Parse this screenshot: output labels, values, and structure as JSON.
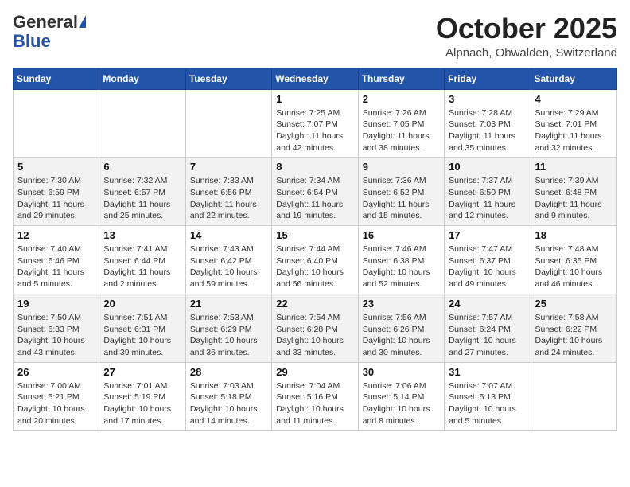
{
  "header": {
    "logo_general": "General",
    "logo_blue": "Blue",
    "month_title": "October 2025",
    "location": "Alpnach, Obwalden, Switzerland"
  },
  "days_of_week": [
    "Sunday",
    "Monday",
    "Tuesday",
    "Wednesday",
    "Thursday",
    "Friday",
    "Saturday"
  ],
  "weeks": [
    [
      {
        "day": "",
        "info": ""
      },
      {
        "day": "",
        "info": ""
      },
      {
        "day": "",
        "info": ""
      },
      {
        "day": "1",
        "info": "Sunrise: 7:25 AM\nSunset: 7:07 PM\nDaylight: 11 hours and 42 minutes."
      },
      {
        "day": "2",
        "info": "Sunrise: 7:26 AM\nSunset: 7:05 PM\nDaylight: 11 hours and 38 minutes."
      },
      {
        "day": "3",
        "info": "Sunrise: 7:28 AM\nSunset: 7:03 PM\nDaylight: 11 hours and 35 minutes."
      },
      {
        "day": "4",
        "info": "Sunrise: 7:29 AM\nSunset: 7:01 PM\nDaylight: 11 hours and 32 minutes."
      }
    ],
    [
      {
        "day": "5",
        "info": "Sunrise: 7:30 AM\nSunset: 6:59 PM\nDaylight: 11 hours and 29 minutes."
      },
      {
        "day": "6",
        "info": "Sunrise: 7:32 AM\nSunset: 6:57 PM\nDaylight: 11 hours and 25 minutes."
      },
      {
        "day": "7",
        "info": "Sunrise: 7:33 AM\nSunset: 6:56 PM\nDaylight: 11 hours and 22 minutes."
      },
      {
        "day": "8",
        "info": "Sunrise: 7:34 AM\nSunset: 6:54 PM\nDaylight: 11 hours and 19 minutes."
      },
      {
        "day": "9",
        "info": "Sunrise: 7:36 AM\nSunset: 6:52 PM\nDaylight: 11 hours and 15 minutes."
      },
      {
        "day": "10",
        "info": "Sunrise: 7:37 AM\nSunset: 6:50 PM\nDaylight: 11 hours and 12 minutes."
      },
      {
        "day": "11",
        "info": "Sunrise: 7:39 AM\nSunset: 6:48 PM\nDaylight: 11 hours and 9 minutes."
      }
    ],
    [
      {
        "day": "12",
        "info": "Sunrise: 7:40 AM\nSunset: 6:46 PM\nDaylight: 11 hours and 5 minutes."
      },
      {
        "day": "13",
        "info": "Sunrise: 7:41 AM\nSunset: 6:44 PM\nDaylight: 11 hours and 2 minutes."
      },
      {
        "day": "14",
        "info": "Sunrise: 7:43 AM\nSunset: 6:42 PM\nDaylight: 10 hours and 59 minutes."
      },
      {
        "day": "15",
        "info": "Sunrise: 7:44 AM\nSunset: 6:40 PM\nDaylight: 10 hours and 56 minutes."
      },
      {
        "day": "16",
        "info": "Sunrise: 7:46 AM\nSunset: 6:38 PM\nDaylight: 10 hours and 52 minutes."
      },
      {
        "day": "17",
        "info": "Sunrise: 7:47 AM\nSunset: 6:37 PM\nDaylight: 10 hours and 49 minutes."
      },
      {
        "day": "18",
        "info": "Sunrise: 7:48 AM\nSunset: 6:35 PM\nDaylight: 10 hours and 46 minutes."
      }
    ],
    [
      {
        "day": "19",
        "info": "Sunrise: 7:50 AM\nSunset: 6:33 PM\nDaylight: 10 hours and 43 minutes."
      },
      {
        "day": "20",
        "info": "Sunrise: 7:51 AM\nSunset: 6:31 PM\nDaylight: 10 hours and 39 minutes."
      },
      {
        "day": "21",
        "info": "Sunrise: 7:53 AM\nSunset: 6:29 PM\nDaylight: 10 hours and 36 minutes."
      },
      {
        "day": "22",
        "info": "Sunrise: 7:54 AM\nSunset: 6:28 PM\nDaylight: 10 hours and 33 minutes."
      },
      {
        "day": "23",
        "info": "Sunrise: 7:56 AM\nSunset: 6:26 PM\nDaylight: 10 hours and 30 minutes."
      },
      {
        "day": "24",
        "info": "Sunrise: 7:57 AM\nSunset: 6:24 PM\nDaylight: 10 hours and 27 minutes."
      },
      {
        "day": "25",
        "info": "Sunrise: 7:58 AM\nSunset: 6:22 PM\nDaylight: 10 hours and 24 minutes."
      }
    ],
    [
      {
        "day": "26",
        "info": "Sunrise: 7:00 AM\nSunset: 5:21 PM\nDaylight: 10 hours and 20 minutes."
      },
      {
        "day": "27",
        "info": "Sunrise: 7:01 AM\nSunset: 5:19 PM\nDaylight: 10 hours and 17 minutes."
      },
      {
        "day": "28",
        "info": "Sunrise: 7:03 AM\nSunset: 5:18 PM\nDaylight: 10 hours and 14 minutes."
      },
      {
        "day": "29",
        "info": "Sunrise: 7:04 AM\nSunset: 5:16 PM\nDaylight: 10 hours and 11 minutes."
      },
      {
        "day": "30",
        "info": "Sunrise: 7:06 AM\nSunset: 5:14 PM\nDaylight: 10 hours and 8 minutes."
      },
      {
        "day": "31",
        "info": "Sunrise: 7:07 AM\nSunset: 5:13 PM\nDaylight: 10 hours and 5 minutes."
      },
      {
        "day": "",
        "info": ""
      }
    ]
  ]
}
